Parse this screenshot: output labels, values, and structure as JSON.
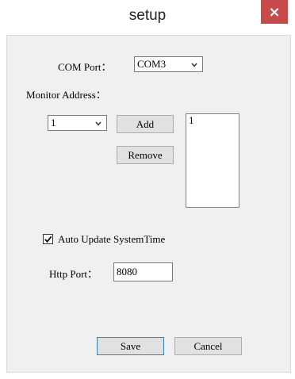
{
  "window": {
    "title": "setup",
    "close_glyph": "×"
  },
  "com_port": {
    "label": "COM Port：",
    "value": "COM3"
  },
  "monitor_address": {
    "label": "Monitor Address：",
    "selected": "1",
    "add_label": "Add",
    "remove_label": "Remove",
    "list_items": [
      "1"
    ]
  },
  "auto_update": {
    "label": "Auto Update SystemTime",
    "checked": true
  },
  "http_port": {
    "label": "Http Port：",
    "value": "8080"
  },
  "buttons": {
    "save_label": "Save",
    "cancel_label": "Cancel"
  },
  "colors": {
    "close_button": "#c74a4a",
    "client_background": "#f0f0f0",
    "default_button_border": "#3c7fb1"
  },
  "icons": {
    "dropdown": "chevron-down-icon",
    "checkbox": "checkmark-icon",
    "close": "close-icon"
  }
}
